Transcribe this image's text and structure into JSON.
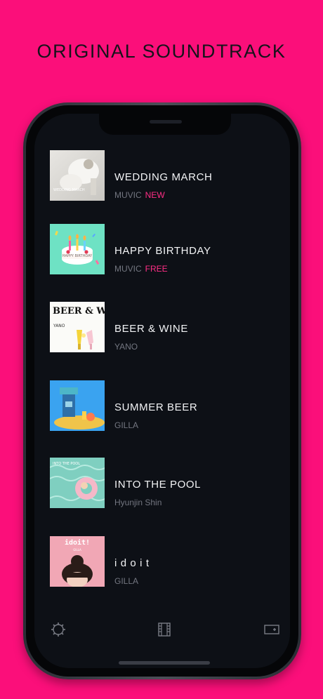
{
  "headline": "ORIGINAL SOUNDTRACK",
  "tracks": [
    {
      "title": "WEDDING MARCH",
      "artist": "MUVIC",
      "badge": "NEW",
      "cover_text": "WEDDING MARCH"
    },
    {
      "title": "HAPPY BIRTHDAY",
      "artist": "MUVIC",
      "badge": "FREE",
      "cover_text": "HAPPY BIRTHDAY"
    },
    {
      "title": "BEER & WINE",
      "artist": "YANO",
      "badge": "",
      "cover_text": "BEER & WINE",
      "cover_sub": "YANO"
    },
    {
      "title": "SUMMER BEER",
      "artist": "GILLA",
      "badge": ""
    },
    {
      "title": "INTO THE POOL",
      "artist": "Hyunjin Shin",
      "badge": "",
      "cover_text": "INTO THE POOL"
    },
    {
      "title": "i d o i t",
      "artist": "GILLA",
      "badge": "",
      "cover_text": "idoit!",
      "cover_sub": "GILLA"
    }
  ],
  "tabbar": {
    "items": [
      "settings-icon",
      "film-icon",
      "ticket-icon"
    ]
  },
  "colors": {
    "background": "#fb0f7a",
    "accent": "#ff2e86",
    "screen": "#0d1016"
  }
}
